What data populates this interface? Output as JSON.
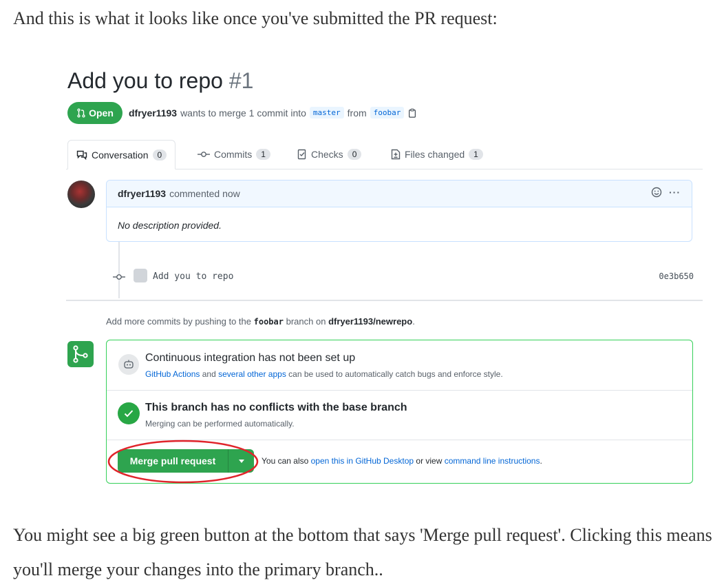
{
  "article": {
    "intro": "And this is what it looks like once you've submitted the PR request:",
    "outro": "You might see a big green button at the bottom that says 'Merge pull request'. Clicking this means you'll merge your changes into the primary branch.."
  },
  "pr": {
    "title": "Add you to repo",
    "number": "#1",
    "state_label": "Open",
    "author": "dfryer1193",
    "meta_text": "wants to merge 1 commit into",
    "base_branch": "master",
    "from_text": "from",
    "head_branch": "foobar"
  },
  "tabs": [
    {
      "label": "Conversation",
      "count": "0"
    },
    {
      "label": "Commits",
      "count": "1"
    },
    {
      "label": "Checks",
      "count": "0"
    },
    {
      "label": "Files changed",
      "count": "1"
    }
  ],
  "comment": {
    "author": "dfryer1193",
    "action": "commented now",
    "body": "No description provided.",
    "more": "···"
  },
  "commit": {
    "message": "Add you to repo",
    "sha": "0e3b650"
  },
  "push_hint": {
    "prefix": "Add more commits by pushing to the",
    "branch": "foobar",
    "middle": "branch on",
    "repo": "dfryer1193/newrepo",
    "suffix": "."
  },
  "merge_box": {
    "ci_title": "Continuous integration has not been set up",
    "ci_link1": "GitHub Actions",
    "ci_and": "and",
    "ci_link2": "several other apps",
    "ci_rest": "can be used to automatically catch bugs and enforce style.",
    "conflict_title": "This branch has no conflicts with the base branch",
    "conflict_sub": "Merging can be performed automatically.",
    "merge_button": "Merge pull request",
    "alt_prefix": "You can also",
    "alt_link1": "open this in GitHub Desktop",
    "alt_middle": "or view",
    "alt_link2": "command line instructions",
    "alt_suffix": "."
  },
  "colors": {
    "green": "#2ea44f",
    "link_blue": "#0366d6",
    "highlight_red": "#e0242b"
  },
  "icons": [
    "pull-request-icon",
    "copy-icon",
    "conversation-icon",
    "commit-icon",
    "checks-icon",
    "files-icon",
    "smiley-icon",
    "kebab-icon",
    "git-merge-icon",
    "ci-icon",
    "check-icon",
    "caret-down-icon"
  ]
}
